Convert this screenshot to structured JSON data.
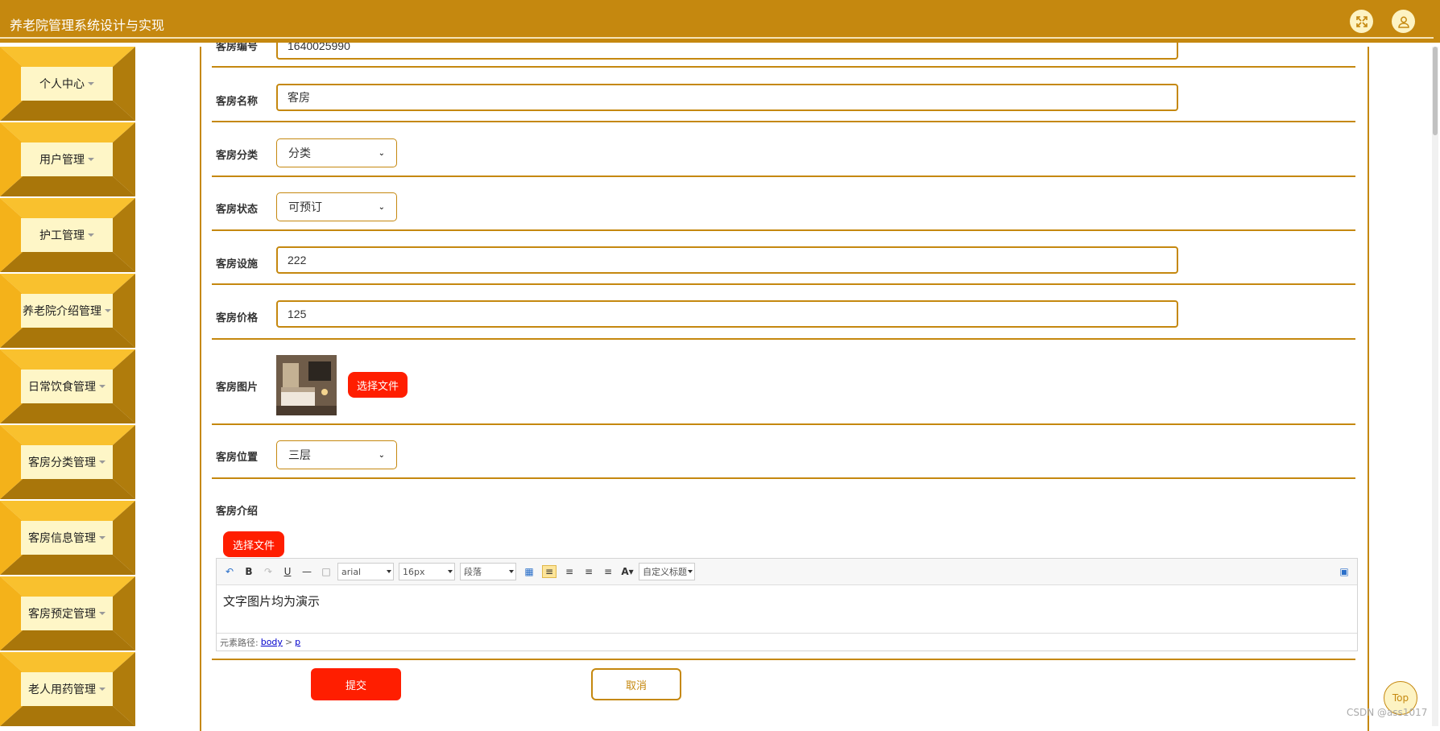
{
  "app": {
    "title": "养老院管理系统设计与实现"
  },
  "header": {
    "fullscreen_icon": "expand-icon",
    "user_icon": "user-icon"
  },
  "sidebar": {
    "items": [
      {
        "label": "个人中心"
      },
      {
        "label": "用户管理"
      },
      {
        "label": "护工管理"
      },
      {
        "label": "养老院介绍管理"
      },
      {
        "label": "日常饮食管理"
      },
      {
        "label": "客房分类管理"
      },
      {
        "label": "客房信息管理"
      },
      {
        "label": "客房预定管理"
      },
      {
        "label": "老人用药管理"
      }
    ]
  },
  "form": {
    "top_partial_label": "客房编号",
    "top_partial_value": "1640025990",
    "room_name": {
      "label": "客房名称",
      "value": "客房"
    },
    "room_category": {
      "label": "客房分类",
      "value": "分类"
    },
    "room_status": {
      "label": "客房状态",
      "value": "可预订"
    },
    "room_facility": {
      "label": "客房设施",
      "value": "222"
    },
    "room_price": {
      "label": "客房价格",
      "value": "125"
    },
    "room_image": {
      "label": "客房图片",
      "button": "选择文件"
    },
    "room_location": {
      "label": "客房位置",
      "value": "三层"
    },
    "room_intro": {
      "label": "客房介绍",
      "button": "选择文件"
    }
  },
  "editor": {
    "font_family": "arial",
    "font_size": "16px",
    "paragraph": "段落",
    "custom_title": "自定义标题",
    "content": "文字图片均为演示",
    "path_label": "元素路径:",
    "path_body": "body",
    "path_sep": ">",
    "path_p": "p"
  },
  "actions": {
    "submit": "提交",
    "cancel": "取消"
  },
  "misc": {
    "top_button": "Top",
    "watermark": "CSDN @ass1017"
  },
  "colors": {
    "primary": "#c5880f",
    "accent_red": "#ff1e00",
    "sidebar_face": "#fef6c7"
  }
}
